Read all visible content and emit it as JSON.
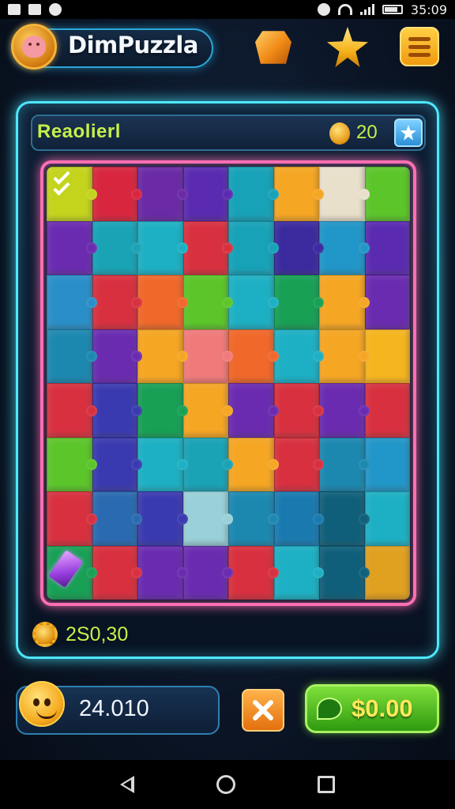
{
  "status_bar": {
    "time": "35:09",
    "icons": [
      "image-icon",
      "n-icon",
      "circle-icon",
      "vibrate-icon",
      "wifi-icon",
      "signal-icon",
      "battery-icon"
    ]
  },
  "header": {
    "app_title": "DimPuzzla",
    "logo_icon": "smiley-badge-icon",
    "buttons": [
      {
        "name": "gem-shop",
        "icon": "gem-icon"
      },
      {
        "name": "favorites",
        "icon": "star-icon"
      },
      {
        "name": "menu",
        "icon": "hamburger-menu-icon"
      }
    ]
  },
  "level": {
    "name": "Reaolierl",
    "coins": "20",
    "coin_icon": "coin-icon",
    "bonus_icon": "star-badge-icon"
  },
  "board": {
    "rows": 8,
    "cols": 8,
    "colors": [
      "#c4d41c",
      "#d8263f",
      "#6b2aa6",
      "#5a2ab0",
      "#17a2b8",
      "#f5a623",
      "#e9e0cc",
      "#5cc52a",
      "#6a2bb0",
      "#19a3b5",
      "#1db0c4",
      "#d8303f",
      "#17a2b8",
      "#3a2a9e",
      "#2196c8",
      "#5a2ab0",
      "#2a8fc8",
      "#d8303f",
      "#f0682a",
      "#5cc52a",
      "#1db0c4",
      "#18a055",
      "#f5a623",
      "#6a2bb0",
      "#1c88b0",
      "#6a2bb0",
      "#f5a623",
      "#f07a7a",
      "#f0682a",
      "#1db0c4",
      "#f5a623",
      "#f5b51e",
      "#d8303f",
      "#3a3ab0",
      "#18a055",
      "#f5a623",
      "#6a2bb0",
      "#d8303f",
      "#6a2bb0",
      "#d8303f",
      "#5cc52a",
      "#3a3ab0",
      "#1db0c4",
      "#19a3b5",
      "#f5a623",
      "#d8303f",
      "#1c88b0",
      "#2196c8",
      "#d8303f",
      "#2a6ab0",
      "#3a3ab0",
      "#9ad0d8",
      "#1c88b0",
      "#1a7ab0",
      "#0f5f7a",
      "#1db0c4",
      "#18a055",
      "#d8303f",
      "#6a2bb0",
      "#6a2bb0",
      "#d8303f",
      "#1db0c4",
      "#0f5f7a",
      "#e0a020",
      "#f5a623",
      "#d8303f",
      "#6a2bb0",
      "#1db0c4",
      "#5cc52a",
      "#d8303f",
      "#f5a623",
      "#e8356a"
    ]
  },
  "score": {
    "value": "2S0,30",
    "icon": "gear-coin-icon"
  },
  "bottom": {
    "balance": "24.010",
    "mascot_icon": "star-mascot-icon",
    "close_icon": "close-icon",
    "buy_label": "$0.00",
    "buy_icon": "price-tag-icon"
  },
  "nav": {
    "icons": [
      "back-icon",
      "home-icon",
      "recents-icon"
    ]
  }
}
